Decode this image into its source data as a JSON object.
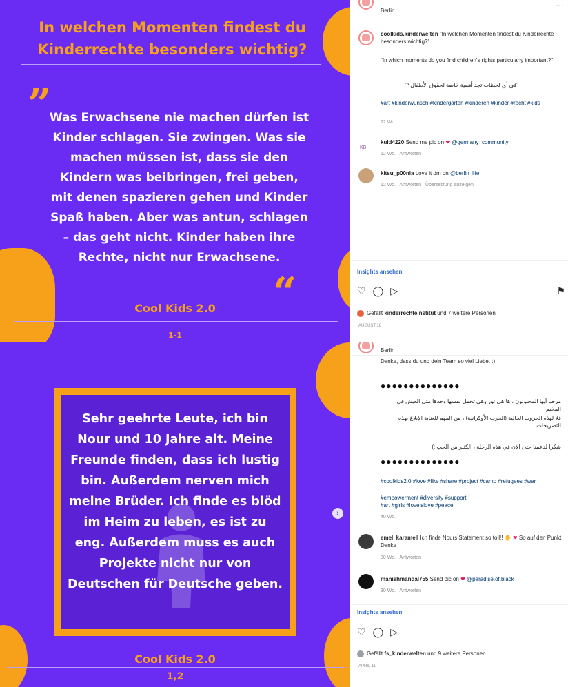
{
  "post1": {
    "slide": {
      "title": "In welchen Momenten findest du Kinderrechte besonders wichtig?",
      "quote_open": "”",
      "quote_close": "“",
      "quote": "Was Erwachsene nie machen dürfen ist Kinder schlagen. Sie zwingen. Was sie machen müssen ist, dass sie den Kindern was beibringen, frei geben, mit denen spazieren gehen und Kinder Spaß haben. Aber was antun, schlagen – das geht nicht. Kinder haben ihre Rechte, nicht nur Erwachsene.",
      "signature": "Cool Kids 2.0",
      "number": "1-1"
    },
    "sidebar": {
      "header_location": "Berlin",
      "more_icon": "…",
      "caption": {
        "username": "coolkids.kinderwelten",
        "text_de": "\"In welchen Momenten findest du Kinderrechte besonders wichtig?\"",
        "text_en": "\"In which moments do you find children's rights particularly important?\"",
        "text_ar": "\"في أي لحظات تجد أهمية خاصة لحقوق الأطفال؟\"",
        "hashtags": "#art #kinderwunsch #kindergarten #kinderen #kinder #recht #kids",
        "time": "12 Wo."
      },
      "comments": [
        {
          "initials": "KB",
          "username": "kuld4220",
          "text": "Send me pic on",
          "heart": "❤",
          "mention": "@germany_community",
          "time": "12 Wo.",
          "reply": "Antworten",
          "translate": ""
        },
        {
          "initials": "",
          "username": "kitsu_p00nia",
          "text": "Love it dm on",
          "heart": "",
          "mention": "@berlin_life",
          "time": "12 Wo.",
          "reply": "Antworten",
          "translate": "Übersetzung anzeigen"
        }
      ],
      "insights": "Insights ansehen",
      "likes_prefix": "Gefällt",
      "likes_user": "kinderrechteinstitut",
      "likes_suffix": "und 7 weitere Personen",
      "date": "AUGUST 18"
    }
  },
  "post2": {
    "slide": {
      "quote": "Sehr geehrte Leute, ich bin Nour und 10 Jahre alt. Meine Freunde finden, dass ich lustig bin. Außerdem nerven mich meine Brüder. Ich finde es blöd im Heim zu leben, es ist zu eng. Außerdem muss es auch Projekte nicht nur von Deutschen für Deutsche geben.",
      "signature": "Cool Kids 2.0",
      "number": "1,2",
      "next_icon": "›"
    },
    "sidebar": {
      "header_location": "Berlin",
      "caption_top": "Danke, dass du und dein Team so viel Liebe. :)",
      "dots": "●●●●●●●●●●●●●●",
      "arabic_1": "مرحبا أيها المحبوبون ، ها هي نور وهي تحمل نفسها وحدها متى العيش في المخيم",
      "arabic_2": "فلا لهذه الحروب الحالية (الحرب الأوكرانية) ، من المهم للعناية الإبلاغ بهذه التصريحات",
      "arabic_3": "شكرا لدعمنا حتى الآن في هذه الرحلة ، الكثير من الحب :)",
      "hashtags_1": "#coolkids2.0 #love #like #share #project #camp #refugees #war",
      "hashtags_2": "#empowerment #diversity #support",
      "hashtags_3": "#art #girls #lovelslove #peace",
      "time": "40 Wo.",
      "comments": [
        {
          "username": "emel_karamell",
          "text": "Ich finde Nours Statement so toll!!",
          "emoji": "✋ ❤",
          "text2": "So auf den Punkt",
          "text3": "Danke",
          "time": "30 Wo.",
          "reply": "Antworten"
        },
        {
          "username": "manishmandal755",
          "text": "Send pic on",
          "heart": "❤",
          "mention": "@paradise.of.black",
          "time": "30 Wo.",
          "reply": "Antworten"
        }
      ],
      "insights": "Insights ansehen",
      "likes_prefix": "Gefällt",
      "likes_user": "fs_kinderwelten",
      "likes_suffix": "und 9 weitere Personen",
      "date": "APRIL 11"
    }
  },
  "icons": {
    "like": "heart-outline-icon",
    "comment": "comment-bubble-icon",
    "share": "paper-plane-icon",
    "save": "bookmark-icon"
  },
  "colors": {
    "slide_background": "#6a2bf3",
    "accent_orange": "#f7a11b",
    "insights_blue": "#2f6ad1",
    "heart_red": "#e0245e"
  }
}
